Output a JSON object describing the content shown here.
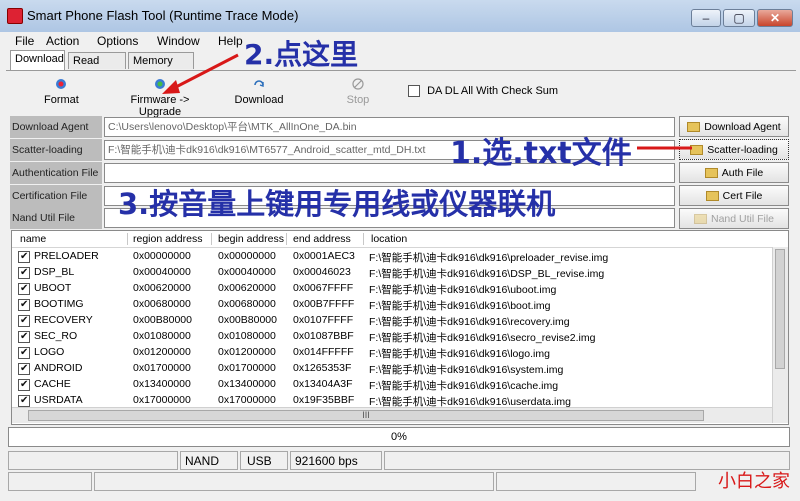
{
  "window": {
    "title": "Smart Phone Flash Tool (Runtime Trace Mode)"
  },
  "menu": [
    "File",
    "Action",
    "Options",
    "Window",
    "Help"
  ],
  "tabs": [
    "Download",
    "Read back",
    "Memory Test"
  ],
  "toolbar": {
    "format": "Format",
    "firmware_upgrade": "Firmware -> Upgrade",
    "download": "Download",
    "stop": "Stop",
    "da_checksum": "DA DL All With Check Sum"
  },
  "fields": {
    "download_agent": {
      "label": "Download Agent",
      "value": "C:\\Users\\lenovo\\Desktop\\平台\\MTK_AllInOne_DA.bin"
    },
    "scatter": {
      "label": "Scatter-loading File",
      "value": "F:\\智能手机\\迪卡dk916\\dk916\\MT6577_Android_scatter_mtd_DH.txt"
    },
    "auth": {
      "label": "Authentication File",
      "value": ""
    },
    "cert": {
      "label": "Certification File",
      "value": ""
    },
    "nand": {
      "label": "Nand Util File",
      "value": ""
    }
  },
  "buttons": {
    "download_agent": "Download Agent",
    "scatter_loading": "Scatter-loading",
    "auth_file": "Auth File",
    "cert_file": "Cert File",
    "nand_util_file": "Nand Util File"
  },
  "table": {
    "columns": [
      "name",
      "region address",
      "begin address",
      "end address",
      "location"
    ],
    "rows": [
      {
        "name": "PRELOADER",
        "region": "0x00000000",
        "begin": "0x00000000",
        "end": "0x0001AEC3",
        "location": "F:\\智能手机\\迪卡dk916\\dk916\\preloader_revise.img"
      },
      {
        "name": "DSP_BL",
        "region": "0x00040000",
        "begin": "0x00040000",
        "end": "0x00046023",
        "location": "F:\\智能手机\\迪卡dk916\\dk916\\DSP_BL_revise.img"
      },
      {
        "name": "UBOOT",
        "region": "0x00620000",
        "begin": "0x00620000",
        "end": "0x0067FFFF",
        "location": "F:\\智能手机\\迪卡dk916\\dk916\\uboot.img"
      },
      {
        "name": "BOOTIMG",
        "region": "0x00680000",
        "begin": "0x00680000",
        "end": "0x00B7FFFF",
        "location": "F:\\智能手机\\迪卡dk916\\dk916\\boot.img"
      },
      {
        "name": "RECOVERY",
        "region": "0x00B80000",
        "begin": "0x00B80000",
        "end": "0x0107FFFF",
        "location": "F:\\智能手机\\迪卡dk916\\dk916\\recovery.img"
      },
      {
        "name": "SEC_RO",
        "region": "0x01080000",
        "begin": "0x01080000",
        "end": "0x01087BBF",
        "location": "F:\\智能手机\\迪卡dk916\\dk916\\secro_revise2.img"
      },
      {
        "name": "LOGO",
        "region": "0x01200000",
        "begin": "0x01200000",
        "end": "0x014FFFFF",
        "location": "F:\\智能手机\\迪卡dk916\\dk916\\logo.img"
      },
      {
        "name": "ANDROID",
        "region": "0x01700000",
        "begin": "0x01700000",
        "end": "0x1265353F",
        "location": "F:\\智能手机\\迪卡dk916\\dk916\\system.img"
      },
      {
        "name": "CACHE",
        "region": "0x13400000",
        "begin": "0x13400000",
        "end": "0x13404A3F",
        "location": "F:\\智能手机\\迪卡dk916\\dk916\\cache.img"
      },
      {
        "name": "USRDATA",
        "region": "0x17000000",
        "begin": "0x17000000",
        "end": "0x19F35BBF",
        "location": "F:\\智能手机\\迪卡dk916\\dk916\\userdata.img"
      }
    ],
    "hscroll_marker": "III"
  },
  "progress": {
    "text": "0%",
    "fraction": 0
  },
  "statusbar": {
    "storage": "NAND",
    "port": "USB",
    "baud": "921600 bps"
  },
  "annotations": {
    "step1": "1.选.txt文件",
    "step2": "2.点这里",
    "step3": "3.按音量上键用专用线或仪器联机"
  },
  "watermark": "小白之家",
  "colors": {
    "annotation": "#2530a8",
    "arrow": "#d81818",
    "watermark": "#d81818"
  }
}
